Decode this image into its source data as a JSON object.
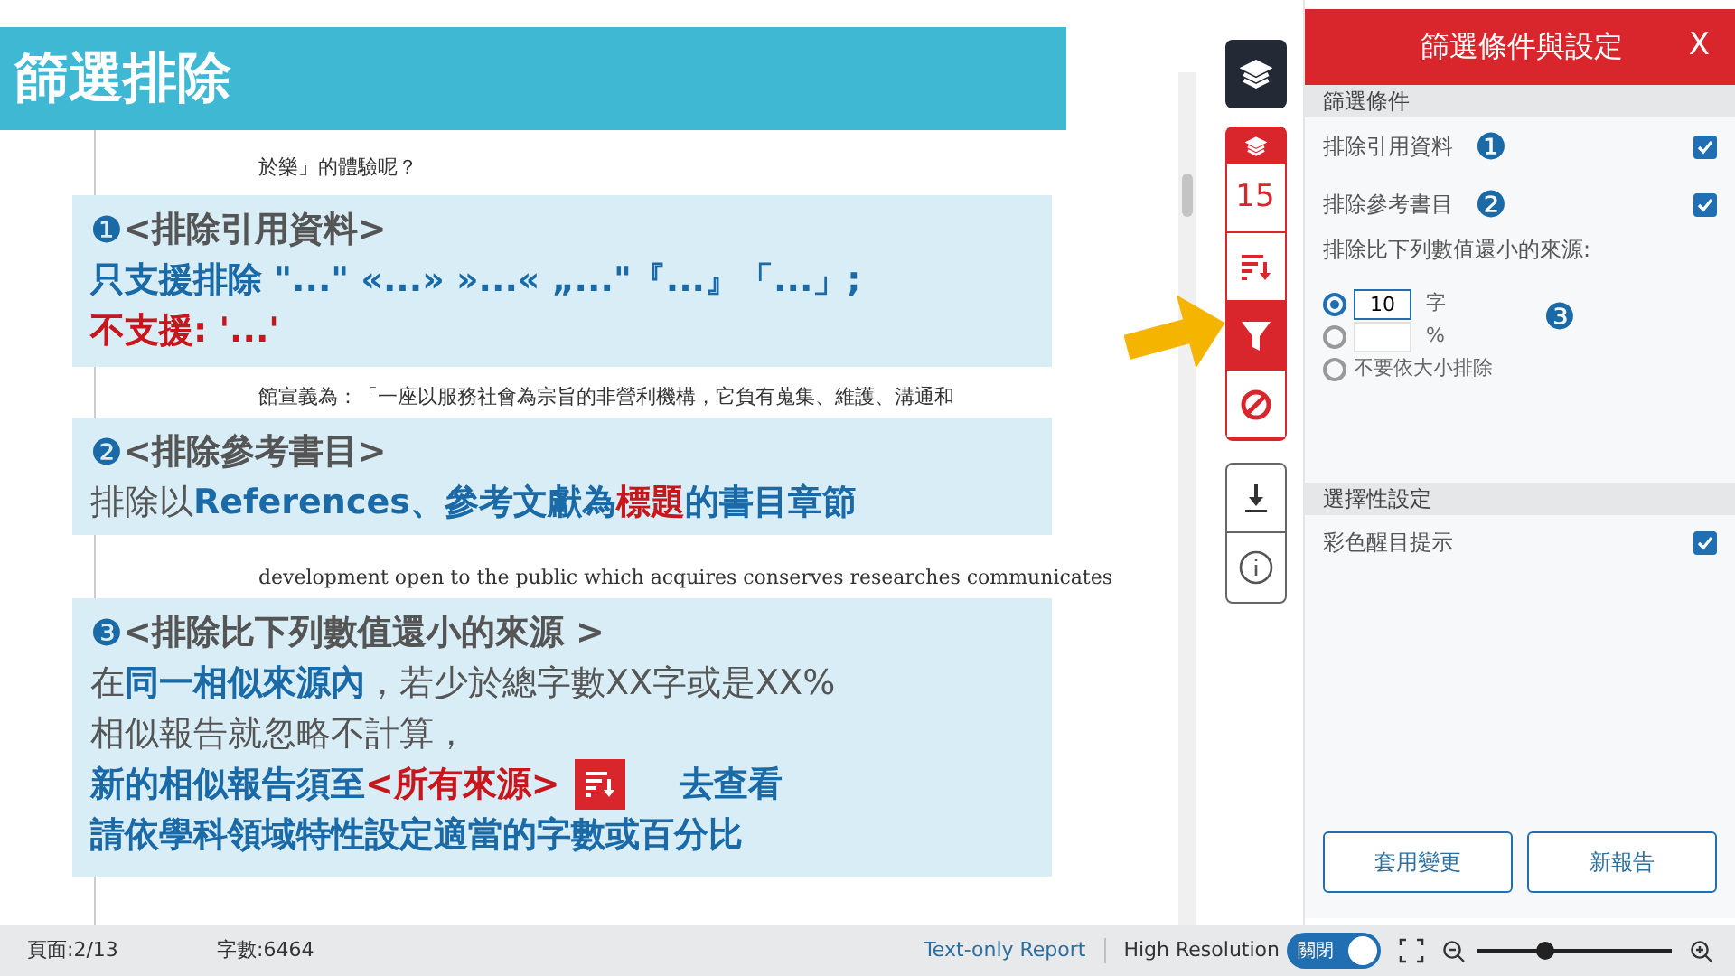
{
  "slide_title": "篩選排除",
  "document": {
    "lines": [
      "於樂」的體驗呢？",
      "館宣義為：「一座以服務社會為宗旨的非營利機構，它負有蒐集、維護、溝通和",
      "development  open to the public  which acquires  conserves  researches  communicates"
    ]
  },
  "callouts": [
    {
      "number": "❶",
      "lines": [
        [
          {
            "text": "<排除引用資料>",
            "color": "#555555"
          }
        ],
        [
          {
            "text": "只支援排除 \"...\" «...» »...« „...\"『...』「...」;",
            "color": "#1b6aa8"
          }
        ],
        [
          {
            "text": "不支援: '...'",
            "color": "#c8161d"
          }
        ]
      ]
    },
    {
      "number": "❷",
      "lines": [
        [
          {
            "text": "<排除參考書目>",
            "color": "#555555"
          }
        ],
        [
          {
            "text": "排除以",
            "color": "#555555"
          },
          {
            "text": "References、參考文獻為 ",
            "color": "#1b6aa8"
          },
          {
            "text": "標題",
            "color": "#c8161d"
          },
          {
            "text": "的書目章節",
            "color": "#1b6aa8"
          }
        ]
      ]
    },
    {
      "number": "❸",
      "lines": [
        [
          {
            "text": "<排除比下列數值還小的來源 >",
            "color": "#555555"
          }
        ],
        [
          {
            "text": "在",
            "color": "#555555"
          },
          {
            "text": "同一相似來源內",
            "color": "#1b6aa8"
          },
          {
            "text": "，若少於總字數XX字或是XX%",
            "color": "#555555"
          }
        ],
        [
          {
            "text": "相似報告就忽略不計算，",
            "color": "#555555"
          }
        ],
        [
          {
            "text": "新的相似報告須至 ",
            "color": "#1b6aa8"
          },
          {
            "text": "<所有來源>",
            "color": "#c8161d"
          },
          {
            "kind": "icon"
          },
          {
            "text": "去查看",
            "color": "#1b6aa8"
          }
        ],
        [
          {
            "text": "請依學科領域特性設定適當的字數或百分比",
            "color": "#1b6aa8"
          }
        ]
      ]
    }
  ],
  "toolbar": {
    "top": {
      "kind": "layers"
    },
    "group": [
      {
        "kind": "layers-small"
      },
      {
        "kind": "count",
        "text": "15"
      },
      {
        "kind": "sort",
        "selected": false
      },
      {
        "kind": "filter",
        "selected": true
      },
      {
        "kind": "block",
        "selected": false
      }
    ],
    "bottom": [
      {
        "kind": "download"
      },
      {
        "kind": "info"
      }
    ]
  },
  "panel": {
    "title": "篩選條件與設定",
    "close": "X",
    "section_1": "篩選條件",
    "options": [
      {
        "label": "排除引用資料",
        "badge": "❶",
        "checked": true
      },
      {
        "label": "排除參考書目",
        "badge": "❷",
        "checked": true
      }
    ],
    "size_label": "排除比下列數值還小的來源:",
    "size_badge": "❸",
    "radios": [
      {
        "value": "10",
        "unit": "字",
        "selected": true
      },
      {
        "unit": "%",
        "selected": false
      },
      {
        "label": "不要依大小排除",
        "selected": false
      }
    ],
    "section_2": "選擇性設定",
    "optional": [
      {
        "label": "彩色醒目提示",
        "checked": true
      }
    ],
    "buttons": [
      "套用變更",
      "新報告"
    ]
  },
  "status_bar": {
    "page": "頁面:2/13",
    "words": "字數:6464",
    "text_only": "Text-only Report",
    "high_res": "High Resolution",
    "toggle": {
      "label": "關閉",
      "on": true
    },
    "zoom": {
      "level": 0.35
    }
  }
}
